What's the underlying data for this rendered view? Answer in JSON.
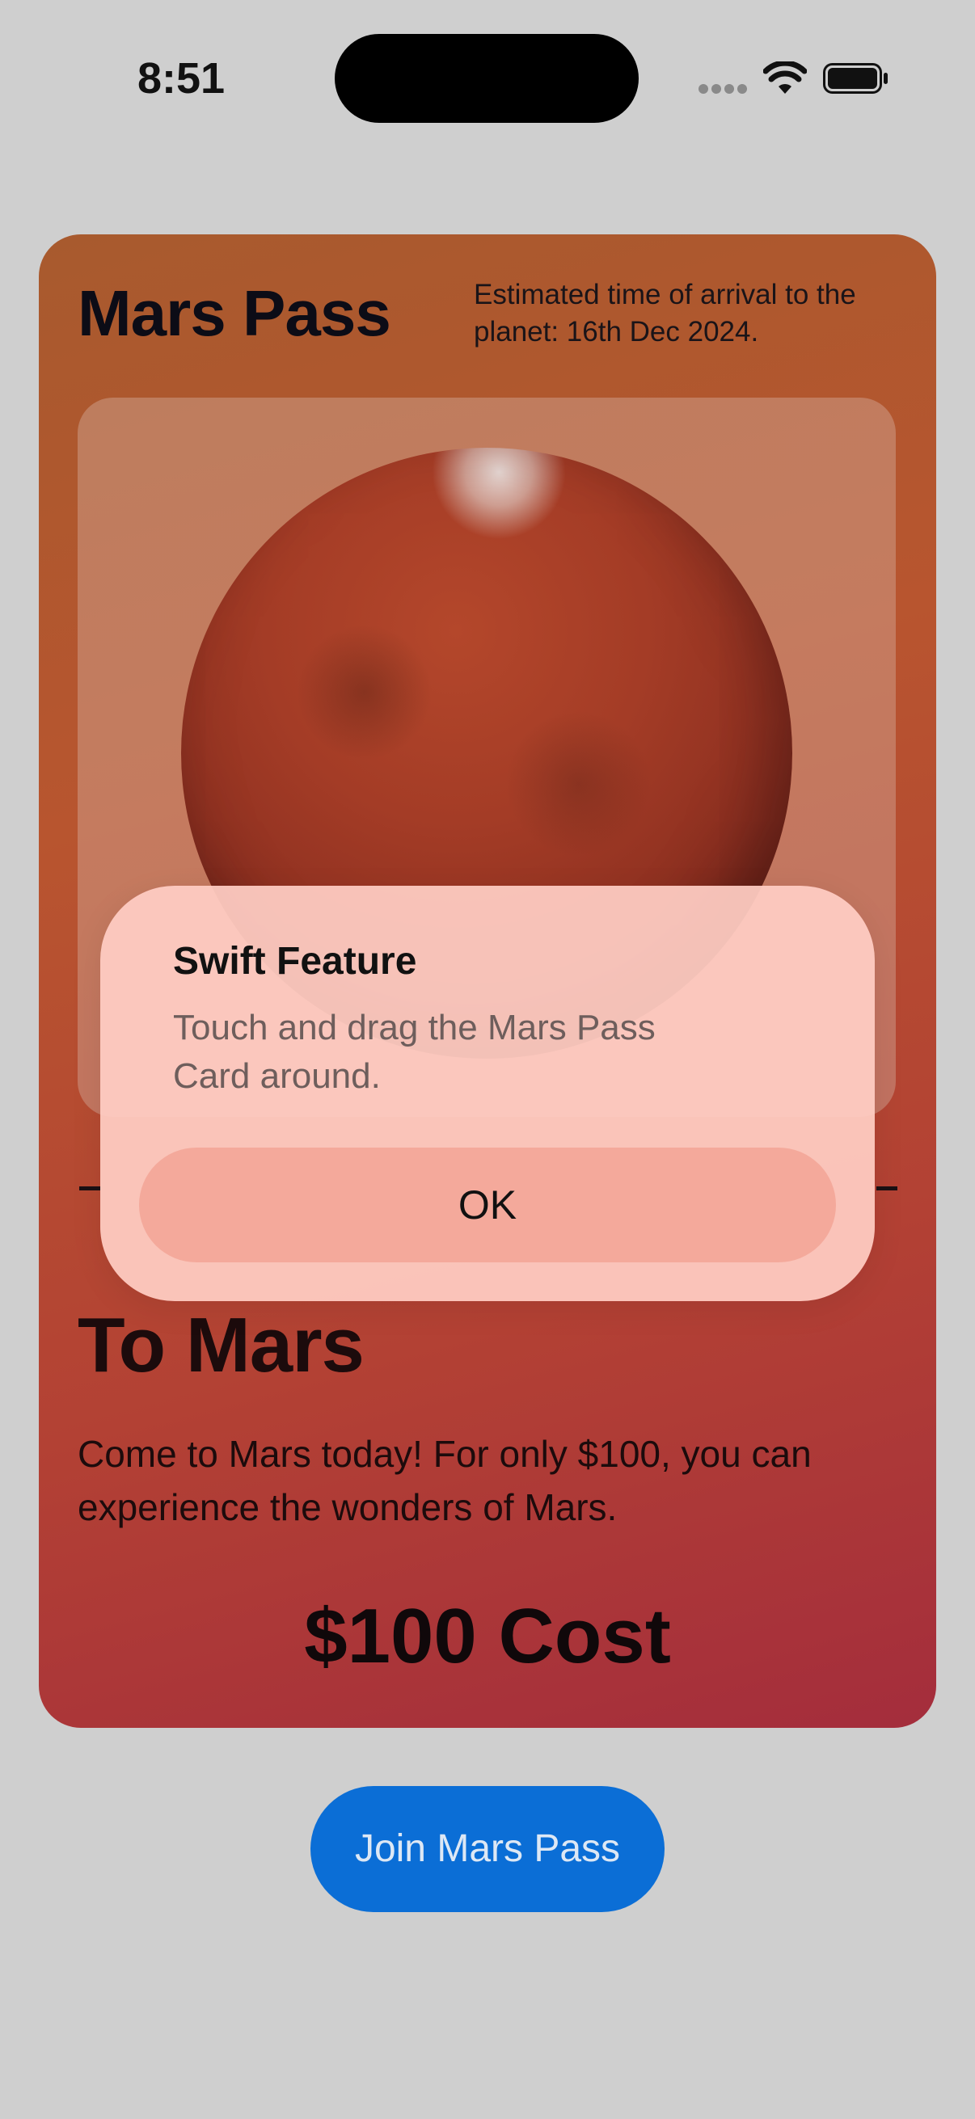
{
  "status_bar": {
    "time": "8:51"
  },
  "card": {
    "title": "Mars Pass",
    "eta": "Estimated time of arrival to the planet: 16th Dec 2024.",
    "heading": "To Mars",
    "description": "Come to Mars today! For only $100, you can experience the wonders of Mars.",
    "cost": "$100 Cost"
  },
  "alert": {
    "title": "Swift Feature",
    "message": "Touch and drag the Mars Pass Card around.",
    "ok_label": "OK"
  },
  "join_button": {
    "label": "Join Mars Pass"
  },
  "colors": {
    "background": "#cfcfcf",
    "card_gradient_start": "#a85a2e",
    "card_gradient_end": "#a42d3c",
    "alert_background": "#ffcec4",
    "alert_button": "#f4a99b",
    "accent_button": "#0b6ed6"
  },
  "icons": [
    "cellular-signal-icon",
    "wifi-icon",
    "battery-icon"
  ]
}
